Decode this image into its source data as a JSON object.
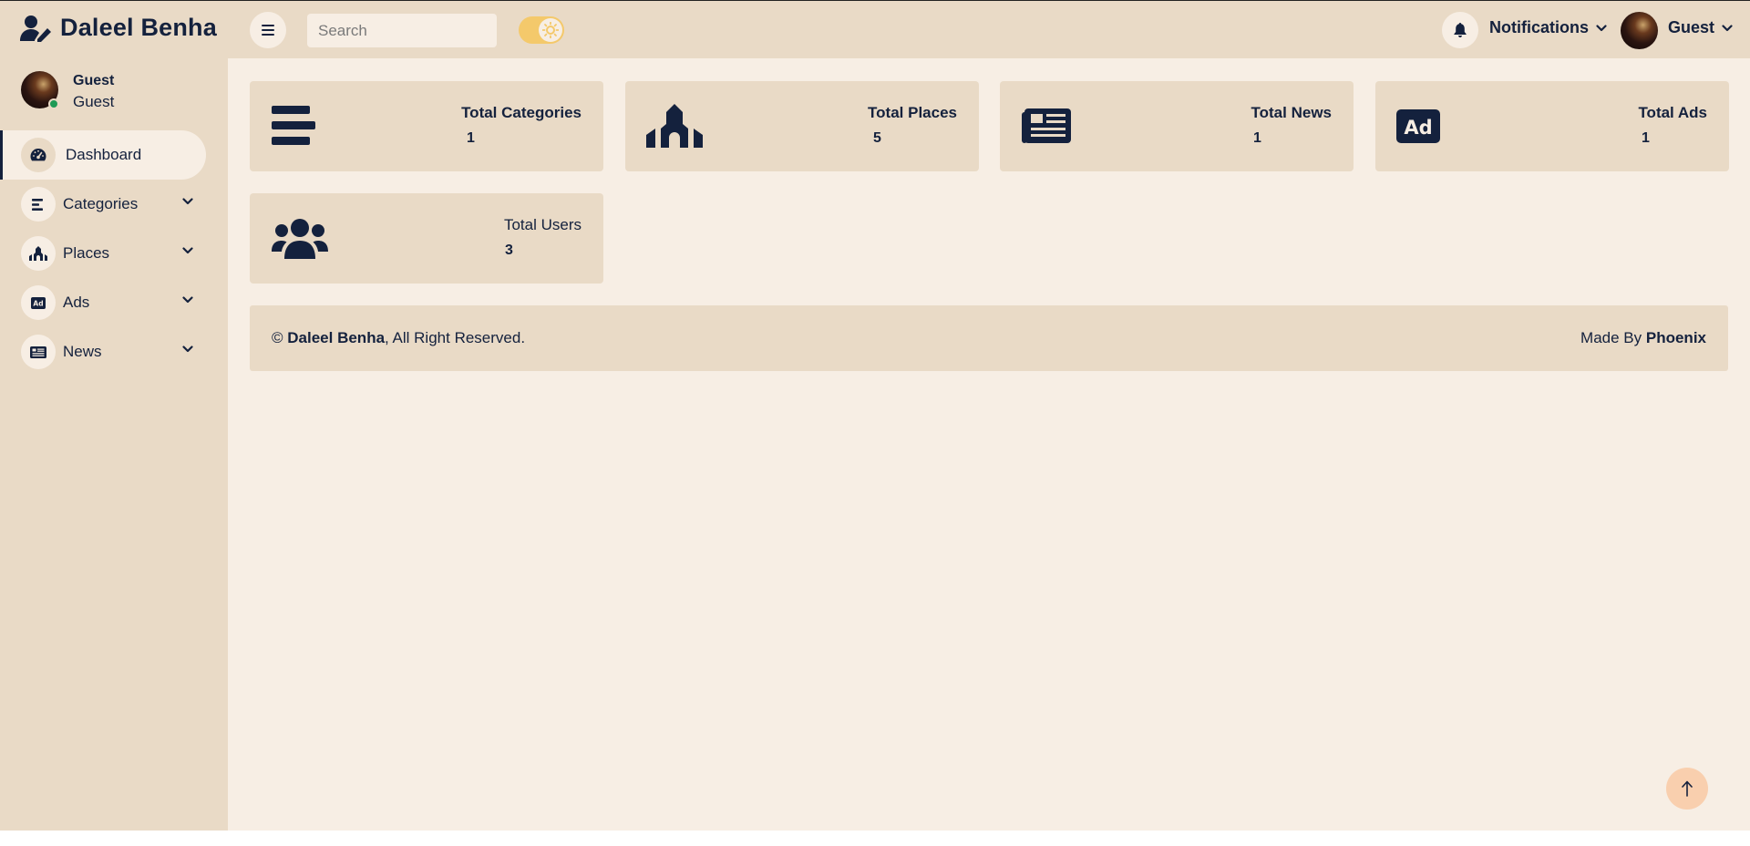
{
  "header": {
    "brand": "Daleel Benha",
    "search_placeholder": "Search",
    "notifications_label": "Notifications",
    "user_label": "Guest"
  },
  "sidebar": {
    "user": {
      "name": "Guest",
      "role": "Guest"
    },
    "items": [
      {
        "label": "Dashboard",
        "icon": "gauge-icon",
        "active": true
      },
      {
        "label": "Categories",
        "icon": "align-left-icon"
      },
      {
        "label": "Places",
        "icon": "church-icon"
      },
      {
        "label": "Ads",
        "icon": "ad-icon"
      },
      {
        "label": "News",
        "icon": "newspaper-icon"
      }
    ]
  },
  "stats": [
    {
      "title": "Total Categories",
      "value": "1",
      "icon": "align-left-icon"
    },
    {
      "title": "Total Places",
      "value": "5",
      "icon": "church-icon"
    },
    {
      "title": "Total News",
      "value": "1",
      "icon": "newspaper-icon"
    },
    {
      "title": "Total Ads",
      "value": "1",
      "icon": "ad-icon"
    },
    {
      "title": "Total Users",
      "value": "3",
      "icon": "users-icon"
    }
  ],
  "footer": {
    "copyright_symbol": "©",
    "brand": "Daleel Benha",
    "rights": ", All Right Reserved.",
    "made_by": "Made By",
    "author": "Phoenix"
  },
  "colors": {
    "primary": "#14213d",
    "background": "#f7eee4",
    "panel": "#e9dac6",
    "toggle": "#f4c96b",
    "scroll_top": "#f9cfae",
    "online": "#1e9a55"
  }
}
